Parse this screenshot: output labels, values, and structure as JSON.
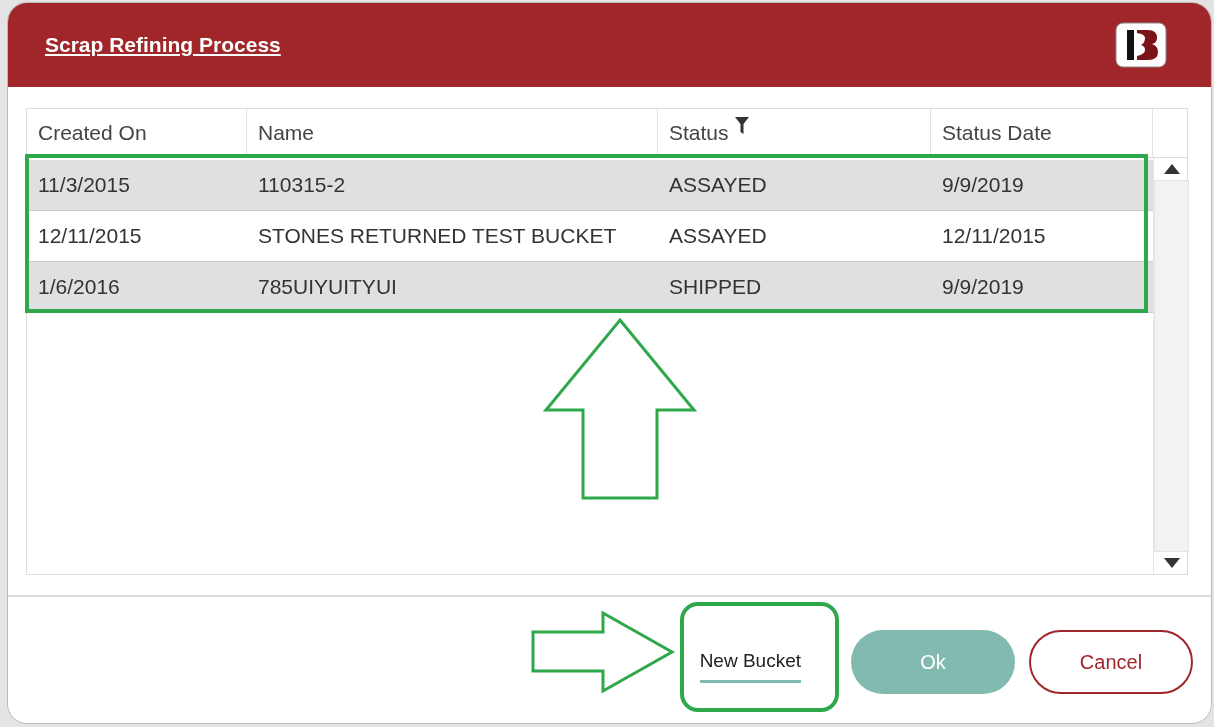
{
  "dialog": {
    "title": "Scrap Refining Process"
  },
  "table": {
    "columns": [
      {
        "label": "Created On",
        "filter": false
      },
      {
        "label": "Name",
        "filter": false
      },
      {
        "label": "Status",
        "filter": true
      },
      {
        "label": "Status Date",
        "filter": false
      }
    ],
    "rows": [
      {
        "cells": [
          "11/3/2015",
          "110315-2",
          "ASSAYED",
          "9/9/2019"
        ]
      },
      {
        "cells": [
          "12/11/2015",
          "STONES RETURNED TEST BUCKET",
          "ASSAYED",
          "12/11/2015"
        ]
      },
      {
        "cells": [
          "1/6/2016",
          "785UIYUITYUI",
          "SHIPPED",
          "9/9/2019"
        ]
      }
    ]
  },
  "buttons": [
    {
      "label": "New Bucket",
      "kind": "link"
    },
    {
      "label": "Ok",
      "kind": "primary"
    },
    {
      "label": "Cancel",
      "kind": "secondary"
    }
  ]
}
